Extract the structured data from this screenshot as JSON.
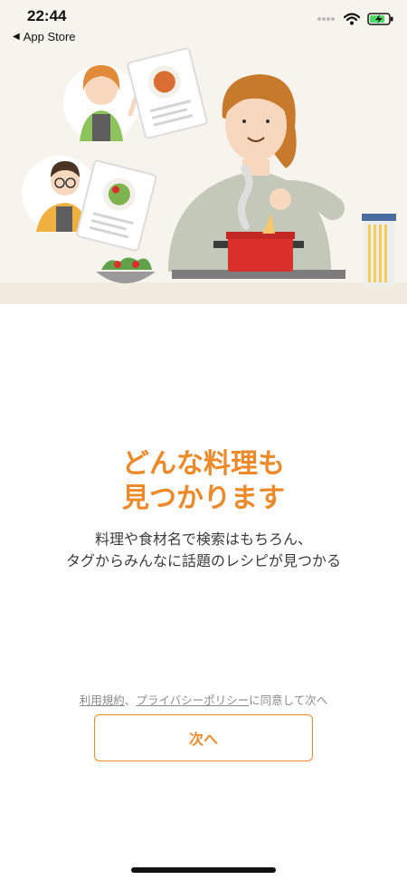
{
  "status_bar": {
    "time": "22:44",
    "back_label": "App Store",
    "icons": [
      "signal-dots-icon",
      "wifi-icon",
      "battery-charging-icon"
    ]
  },
  "onboarding": {
    "headline_line1": "どんな料理も",
    "headline_line2": "見つかります",
    "description_line1": "料理や食材名で検索はもちろん、",
    "description_line2": "タグからみんなに話題のレシピが見つかる",
    "consent": {
      "terms_link": "利用規約",
      "separator": "、",
      "privacy_link": "プライバシーポリシー",
      "suffix": "に同意して次へ"
    },
    "next_button_label": "次へ"
  },
  "colors": {
    "accent": "#ec8a2a",
    "illustration_bg": "#f6f4ec",
    "pot_red": "#d9302a"
  }
}
